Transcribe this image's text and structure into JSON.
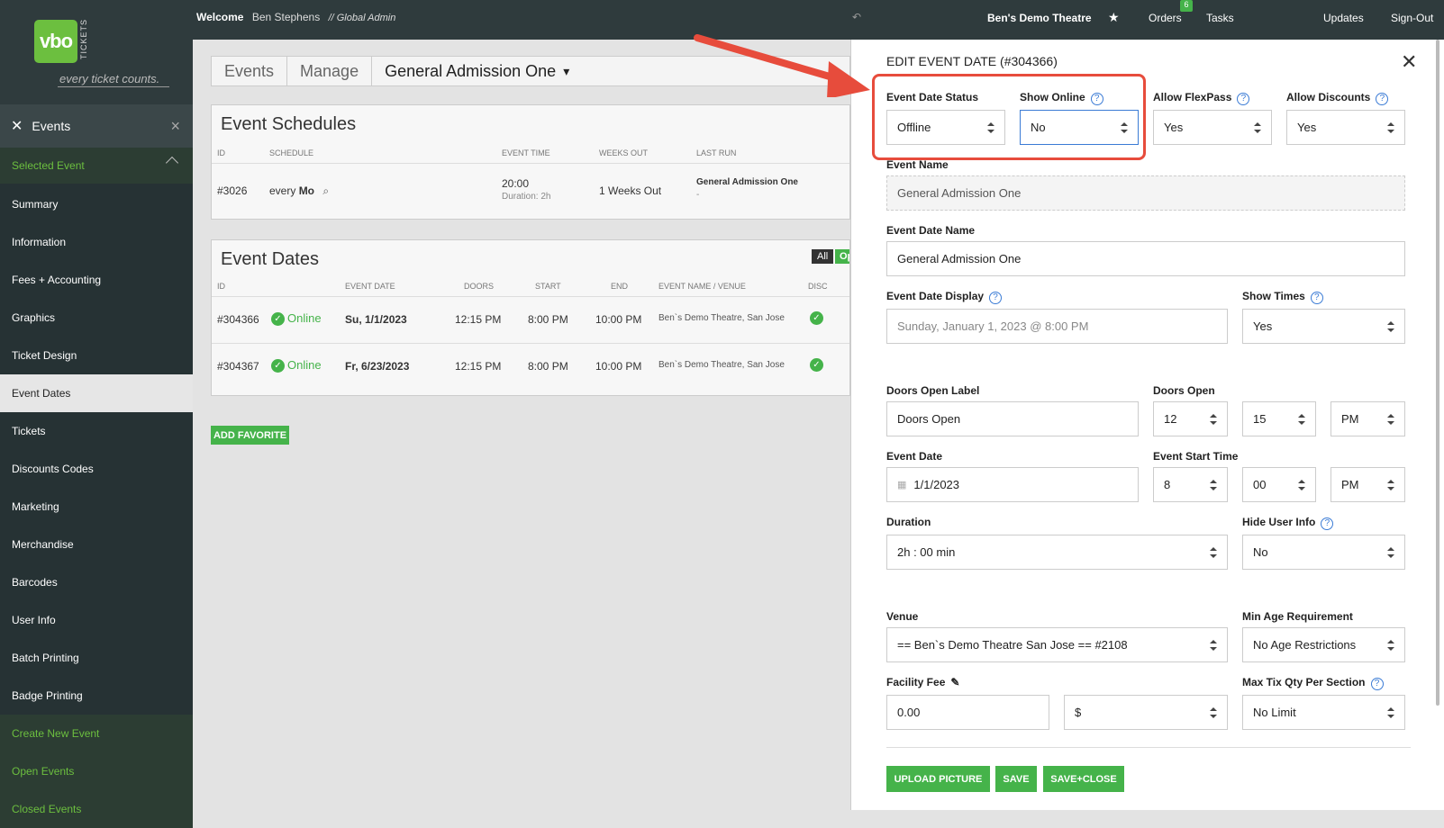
{
  "sidebar": {
    "logo": {
      "mark": "vbo",
      "tickets": "TICKETS",
      "tagline": "every ticket counts."
    },
    "header": "Events",
    "section": "Selected Event",
    "items": [
      "Summary",
      "Information",
      "Fees + Accounting",
      "Graphics",
      "Ticket Design",
      "Event Dates",
      "Tickets",
      "Discounts Codes",
      "Marketing",
      "Merchandise",
      "Barcodes",
      "User Info",
      "Batch Printing",
      "Badge Printing"
    ],
    "links": [
      "Create New Event",
      "Open Events",
      "Closed Events"
    ]
  },
  "topbar": {
    "welcome": "Welcome",
    "user": "Ben Stephens",
    "role": "// Global Admin",
    "venue": "Ben's Demo Theatre",
    "orders": "Orders",
    "orders_badge": "6",
    "tasks": "Tasks",
    "updates": "Updates",
    "signout": "Sign-Out"
  },
  "breadcrumb": {
    "a": "Events",
    "b": "Manage",
    "c": "General Admission One"
  },
  "schedules": {
    "title": "Event Schedules",
    "headers": [
      "ID",
      "SCHEDULE",
      "EVENT TIME",
      "WEEKS OUT",
      "LAST RUN"
    ],
    "row": {
      "id": "#3026",
      "every": "every",
      "day": "Mo",
      "time": "20:00",
      "duration": "Duration: 2h",
      "weeks": "1 Weeks Out",
      "last": "General Admission One",
      "last2": "-"
    }
  },
  "dates": {
    "title": "Event Dates",
    "all": "All",
    "on": "Op",
    "headers": [
      "ID",
      "EVENT DATE",
      "DOORS",
      "START",
      "END",
      "EVENT NAME / VENUE",
      "DISC"
    ],
    "rows": [
      {
        "id": "#304366",
        "status": "Online",
        "date": "Su, 1/1/2023",
        "doors": "12:15 PM",
        "start": "8:00 PM",
        "end": "10:00 PM",
        "venue": "Ben`s Demo Theatre, San Jose"
      },
      {
        "id": "#304367",
        "status": "Online",
        "date": "Fr, 6/23/2023",
        "doors": "12:15 PM",
        "start": "8:00 PM",
        "end": "10:00 PM",
        "venue": "Ben`s Demo Theatre, San Jose"
      }
    ],
    "add_favorite": "ADD FAVORITE"
  },
  "modal": {
    "title": "EDIT EVENT DATE (#304366)",
    "status_label": "Event Date Status",
    "status": "Offline",
    "online_label": "Show Online",
    "online": "No",
    "flex_label": "Allow FlexPass",
    "flex": "Yes",
    "disc_label": "Allow Discounts",
    "disc": "Yes",
    "name_label": "Event Name",
    "name": "General Admission One",
    "dname_label": "Event Date Name",
    "dname": "General Admission One",
    "display_label": "Event Date Display",
    "display": "Sunday, January 1, 2023 @ 8:00 PM",
    "times_label": "Show Times",
    "times": "Yes",
    "doors_label_label": "Doors Open Label",
    "doors_label": "Doors Open",
    "doors_open_label": "Doors Open",
    "doors_h": "12",
    "doors_m": "15",
    "doors_ap": "PM",
    "date_label": "Event Date",
    "date": "1/1/2023",
    "start_label": "Event Start Time",
    "start_h": "8",
    "start_m": "00",
    "start_ap": "PM",
    "duration_label": "Duration",
    "duration": "2h : 00 min",
    "hide_label": "Hide User Info",
    "hide": "No",
    "venue_label": "Venue",
    "venue": "== Ben`s Demo Theatre San Jose == #2108",
    "age_label": "Min Age Requirement",
    "age": "No Age Restrictions",
    "fee_label": "Facility Fee",
    "fee": "0.00",
    "fee_type": "$",
    "max_label": "Max Tix Qty Per Section",
    "max": "No Limit",
    "upload": "UPLOAD PICTURE",
    "save": "SAVE",
    "saveclose": "SAVE+CLOSE"
  },
  "colors": {
    "accent": "#45b34a",
    "highlight": "#e74c3c",
    "sidebar": "#263234"
  }
}
